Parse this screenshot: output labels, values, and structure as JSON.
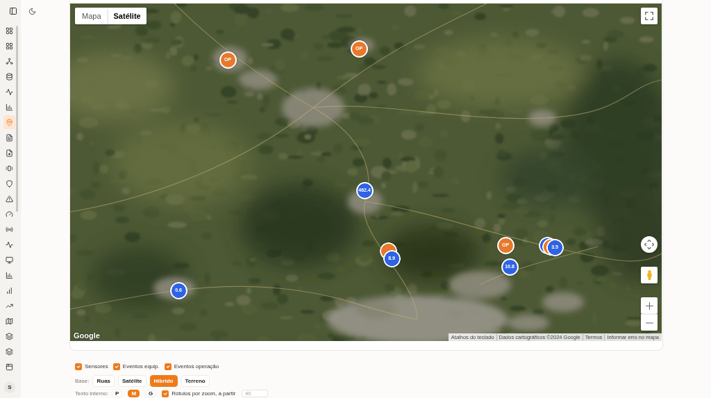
{
  "sidebar": {
    "items": [
      {
        "selected": false
      },
      {
        "selected": false
      },
      {
        "selected": false
      },
      {
        "selected": false
      },
      {
        "selected": false
      },
      {
        "selected": false
      },
      {
        "selected": true
      },
      {
        "selected": false
      },
      {
        "selected": false
      },
      {
        "selected": false
      },
      {
        "selected": false
      },
      {
        "selected": false
      },
      {
        "selected": false
      },
      {
        "selected": false
      },
      {
        "selected": false
      },
      {
        "selected": false
      },
      {
        "selected": false
      },
      {
        "selected": false
      },
      {
        "selected": false
      },
      {
        "selected": false
      },
      {
        "selected": false
      },
      {
        "selected": false
      },
      {
        "selected": false
      }
    ],
    "avatar": "S"
  },
  "map": {
    "type_control": [
      {
        "label": "Mapa",
        "selected": false
      },
      {
        "label": "Satélite",
        "selected": true
      }
    ],
    "markers": [
      {
        "kind": "operation",
        "label": "OP"
      },
      {
        "kind": "operation",
        "label": "OP"
      },
      {
        "kind": "sensor",
        "label": "462.4"
      },
      {
        "kind": "cluster",
        "members": [
          {
            "kind": "operation"
          },
          {
            "kind": "sensor",
            "label": "8.9"
          }
        ]
      },
      {
        "kind": "operation",
        "label": "OP"
      },
      {
        "kind": "sensor",
        "label": "10.8"
      },
      {
        "kind": "cluster",
        "members": [
          {
            "kind": "sensor"
          },
          {
            "kind": "operation"
          },
          {
            "kind": "sensor",
            "label": "3.5"
          }
        ]
      },
      {
        "kind": "sensor",
        "label": "0.6"
      }
    ],
    "logo": "Google",
    "attribution": [
      "Atalhos do teclado",
      "Dados cartográficos ©2024 Google",
      "Termos",
      "Informar erro no mapa"
    ]
  },
  "layers": [
    {
      "label": "Sensores",
      "checked": true
    },
    {
      "label": "Eventos equip.",
      "checked": true
    },
    {
      "label": "Eventos operação",
      "checked": true
    }
  ],
  "base": {
    "label": "Base:",
    "options": [
      {
        "label": "Ruas",
        "selected": false
      },
      {
        "label": "Satélite",
        "selected": false
      },
      {
        "label": "Híbrido",
        "selected": true
      },
      {
        "label": "Terreno",
        "selected": false
      }
    ]
  },
  "text_size": {
    "label": "Texto interno:",
    "options": [
      {
        "label": "P",
        "selected": false
      },
      {
        "label": "M",
        "selected": true
      },
      {
        "label": "G",
        "selected": false
      }
    ]
  },
  "zoom_labels": {
    "label": "Rótulos por zoom, a partir",
    "checked": true,
    "value": "40"
  }
}
